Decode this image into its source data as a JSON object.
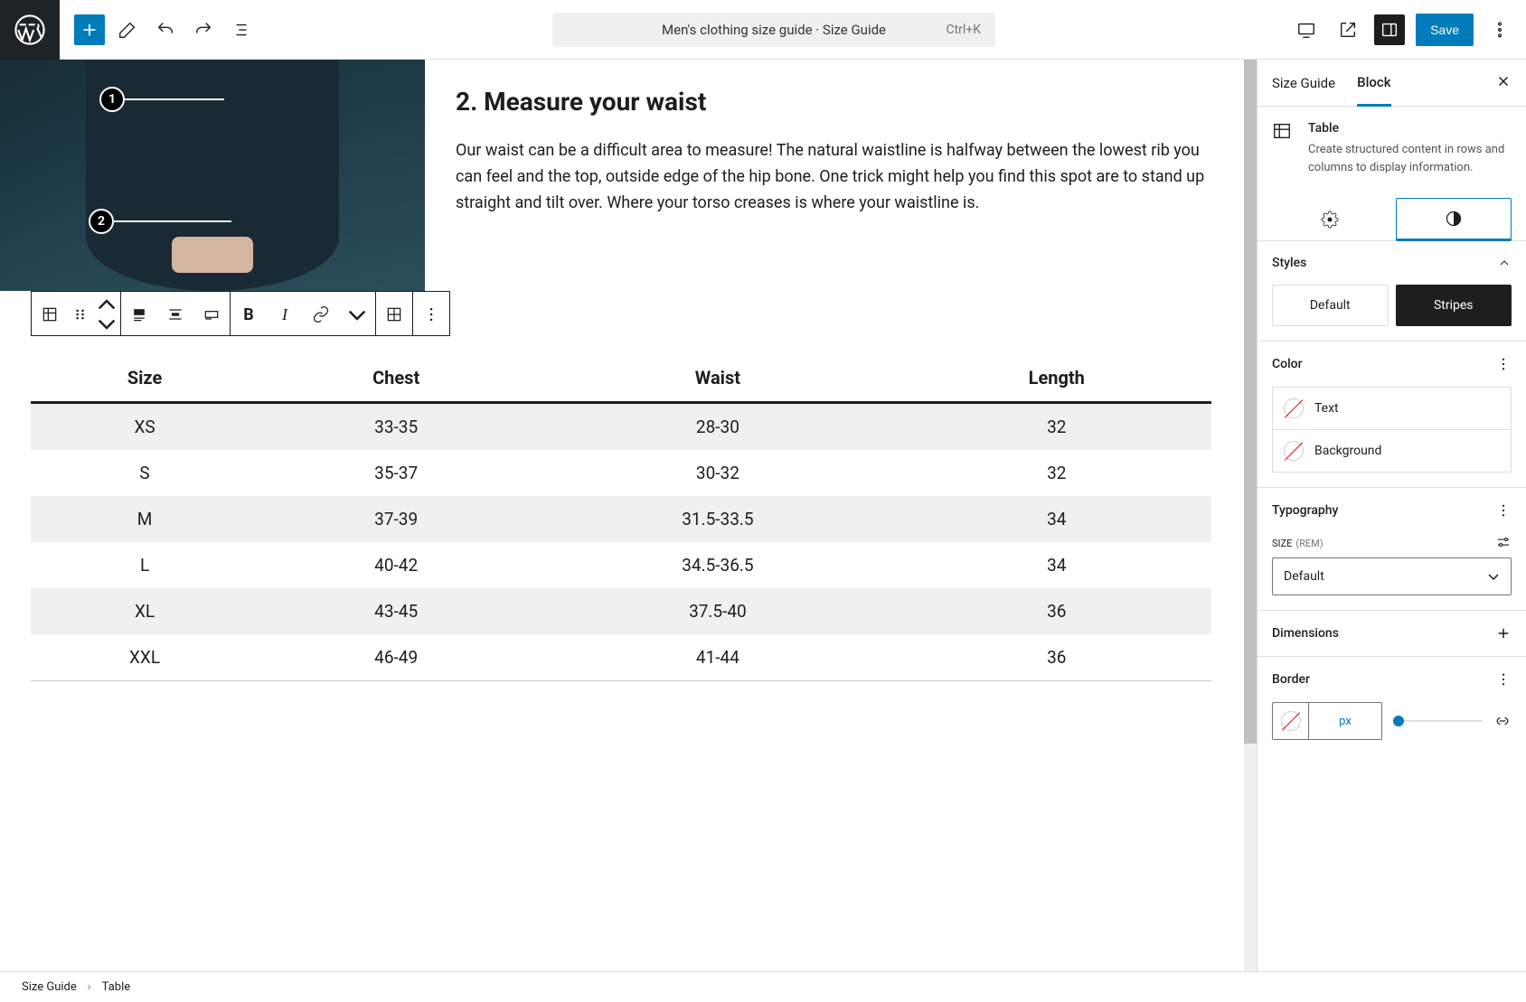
{
  "toolbar": {
    "title": "Men's clothing size guide · Size Guide",
    "shortcut": "Ctrl+K",
    "save_label": "Save"
  },
  "content": {
    "heading": "2. Measure your waist",
    "paragraph": "Our waist can be a difficult area to measure! The natural waistline is halfway between the lowest rib you can feel and the top, outside edge of the hip bone. One trick might help you find this spot are to stand up straight and tilt over. Where your torso creases is where your waistline is.",
    "markers": [
      "1",
      "2"
    ]
  },
  "table": {
    "headers": [
      "Size",
      "Chest",
      "Waist",
      "Length"
    ],
    "rows": [
      [
        "XS",
        "33-35",
        "28-30",
        "32"
      ],
      [
        "S",
        "35-37",
        "30-32",
        "32"
      ],
      [
        "M",
        "37-39",
        "31.5-33.5",
        "34"
      ],
      [
        "L",
        "40-42",
        "34.5-36.5",
        "34"
      ],
      [
        "XL",
        "43-45",
        "37.5-40",
        "36"
      ],
      [
        "XXL",
        "46-49",
        "41-44",
        "36"
      ]
    ]
  },
  "sidebar": {
    "tabs": [
      "Size Guide",
      "Block"
    ],
    "block_name": "Table",
    "block_desc": "Create structured content in rows and columns to display information.",
    "styles": {
      "header": "Styles",
      "options": [
        "Default",
        "Stripes"
      ]
    },
    "color": {
      "header": "Color",
      "text_label": "Text",
      "bg_label": "Background"
    },
    "typography": {
      "header": "Typography",
      "size_label": "SIZE",
      "size_unit": "(REM)",
      "size_value": "Default"
    },
    "dimensions": {
      "header": "Dimensions"
    },
    "border": {
      "header": "Border",
      "unit": "px"
    }
  },
  "breadcrumb": [
    "Size Guide",
    "Table"
  ]
}
